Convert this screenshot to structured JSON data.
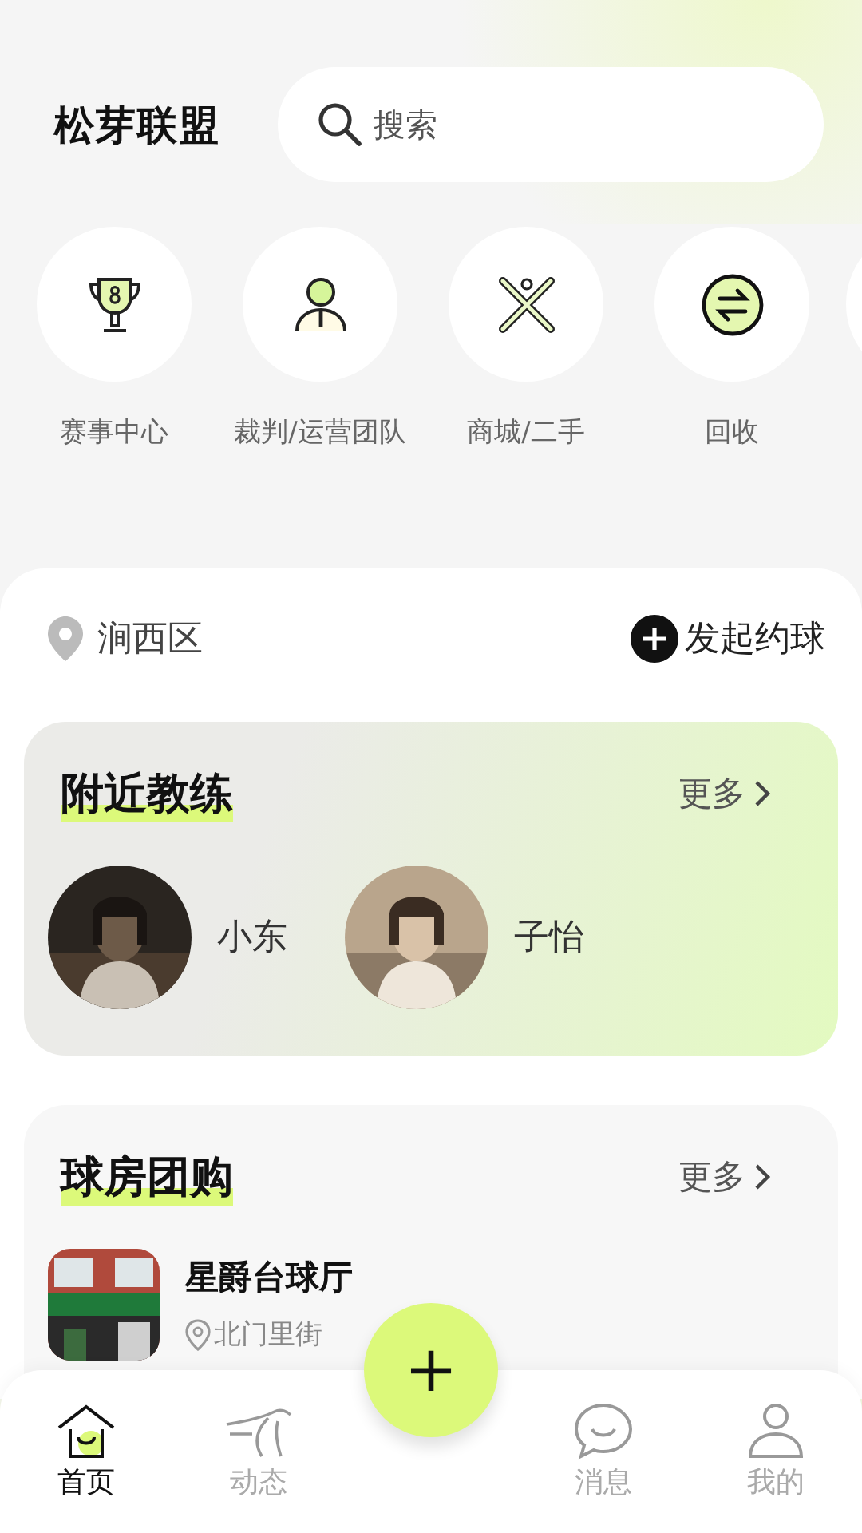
{
  "app_title": "松芽联盟",
  "search": {
    "placeholder": "搜索"
  },
  "shortcuts": [
    {
      "label": "赛事中心"
    },
    {
      "label": "裁判/运营团队"
    },
    {
      "label": "商城/二手"
    },
    {
      "label": "回收"
    }
  ],
  "location": "涧西区",
  "start_button": "发起约球",
  "coaches": {
    "title": "附近教练",
    "more": "更多",
    "items": [
      {
        "name": "小东"
      },
      {
        "name": "子怡"
      }
    ]
  },
  "group_buy": {
    "title": "球房团购",
    "more": "更多",
    "items": [
      {
        "name": "星爵台球厅",
        "address": "北门里街"
      }
    ]
  },
  "fab": "+",
  "tabs": [
    {
      "label": "首页",
      "selected": true
    },
    {
      "label": "动态",
      "selected": false
    },
    {
      "label": "消息",
      "selected": false
    },
    {
      "label": "我的",
      "selected": false
    }
  ]
}
